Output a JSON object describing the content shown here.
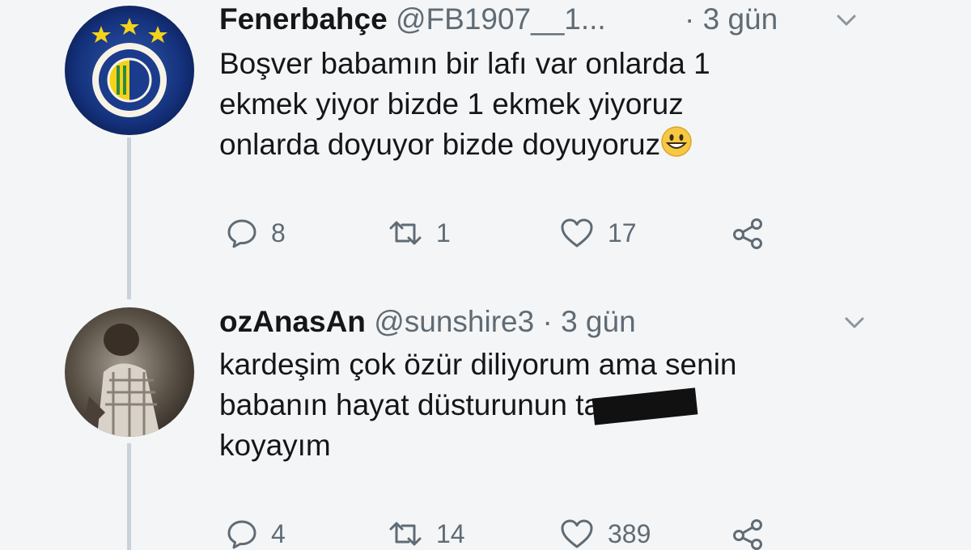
{
  "tweets": [
    {
      "name": "Fenerbahçe",
      "handle": "@FB1907__1...",
      "time": " · 3 gün",
      "lines": [
        "Boşver babamın bir lafı var onlarda 1",
        "ekmek yiyor bizde 1 ekmek yiyoruz",
        "onlarda doyuyor bizde doyuyoruz"
      ],
      "emoji": "smiling-face-emoji",
      "replies": "8",
      "retweets": "1",
      "likes": "17"
    },
    {
      "name": "ozAnasAn",
      "handle": "@sunshire3",
      "time": " · 3 gün",
      "lines": [
        "kardeşim çok özür diliyorum ama senin",
        "babanın hayat düsturunun ta a",
        "koyayım"
      ],
      "redacted": true,
      "replies": "4",
      "retweets": "14",
      "likes": "389"
    }
  ],
  "colors": {
    "background": "#f4f5f6",
    "thread_line": "#c9d2da",
    "muted": "#5f6b75",
    "text": "#14171a"
  }
}
